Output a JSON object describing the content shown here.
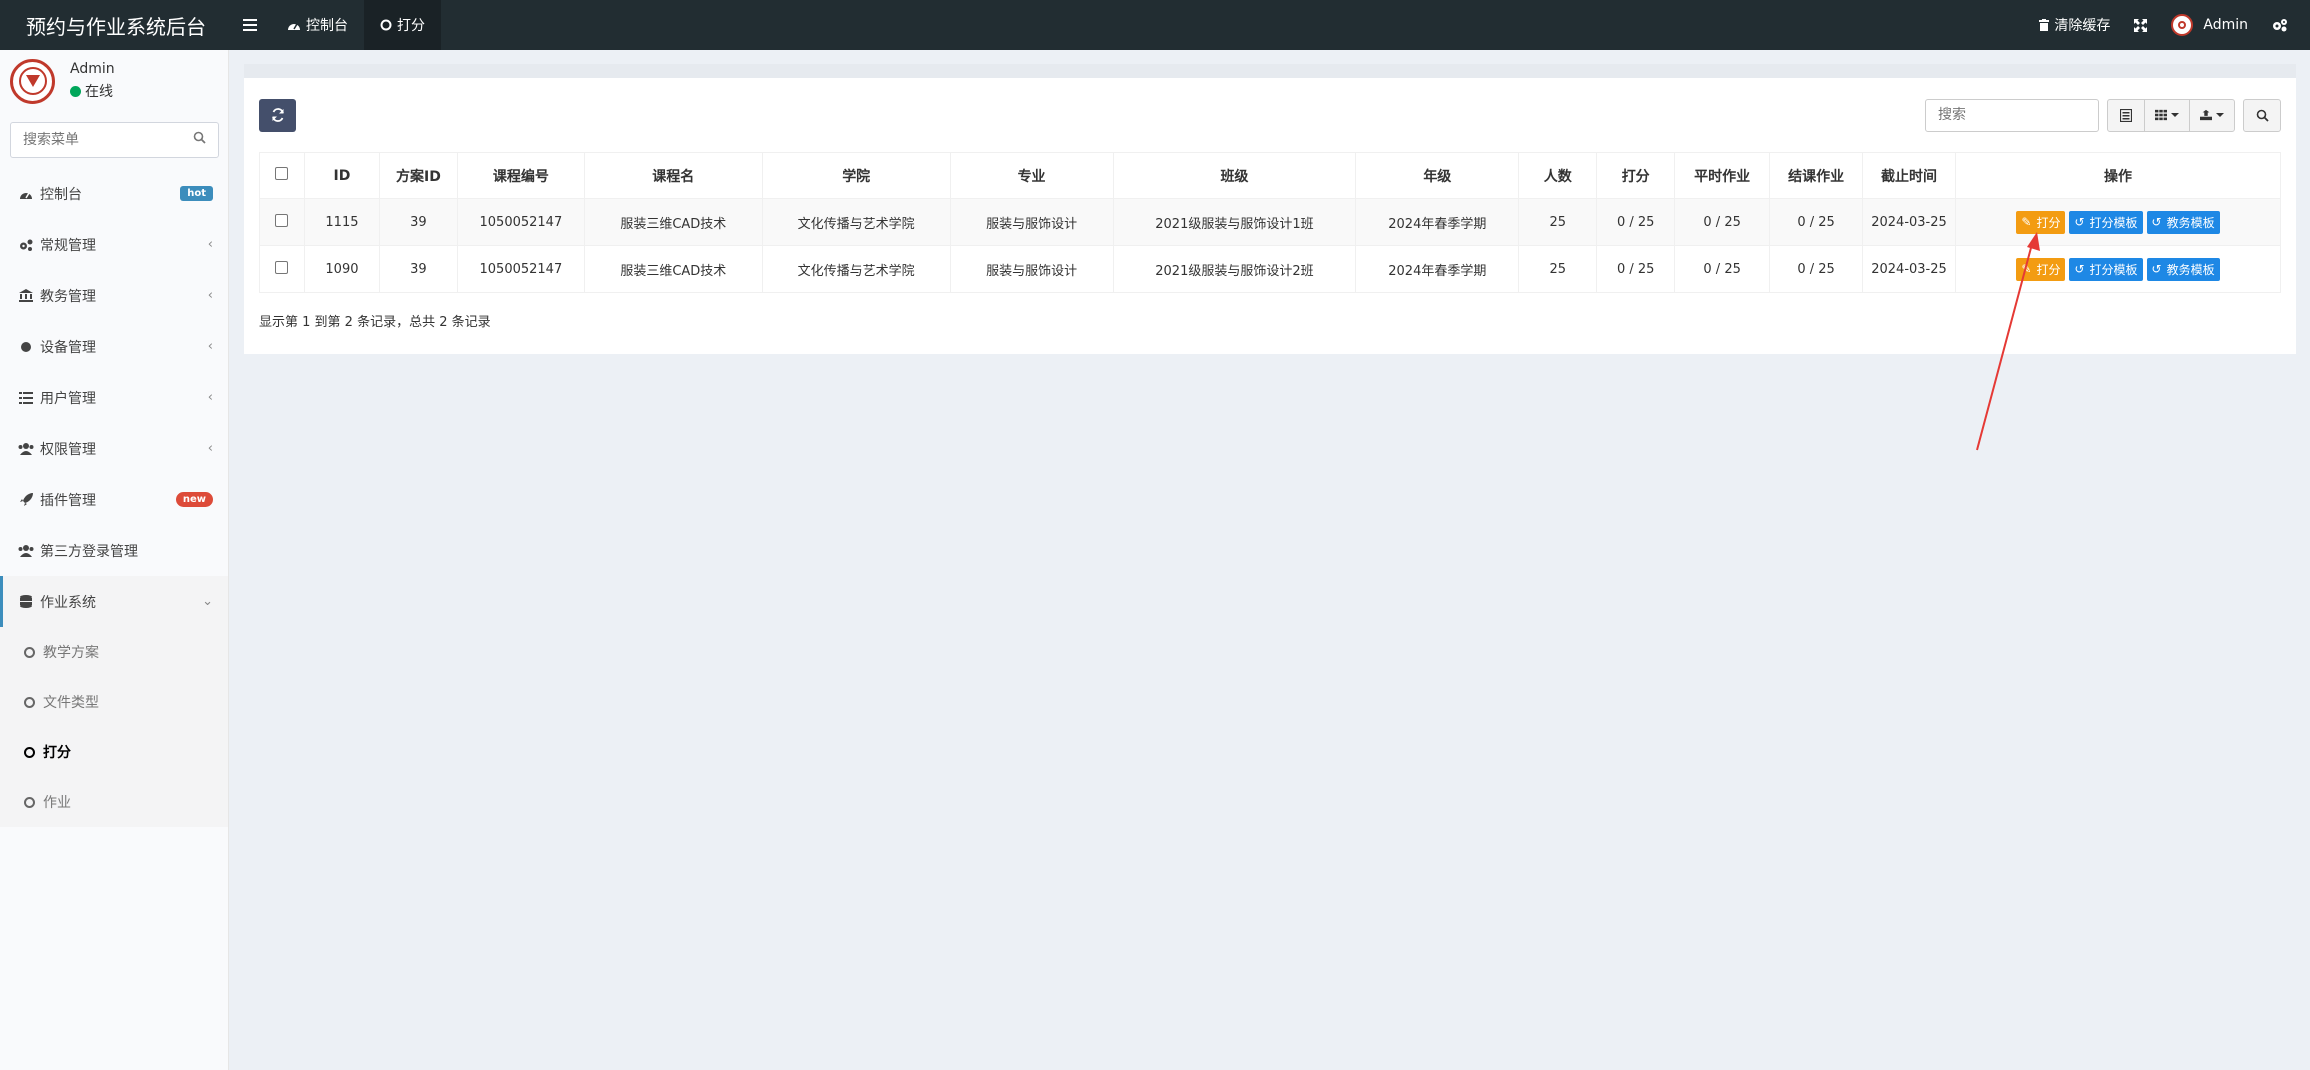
{
  "app": {
    "title": "预约与作业系统后台"
  },
  "topnav": {
    "tabs": [
      {
        "label": "控制台"
      },
      {
        "label": "打分"
      }
    ],
    "clear_cache": "清除缓存",
    "user": "Admin"
  },
  "sidebar": {
    "user": {
      "name": "Admin",
      "status": "在线"
    },
    "search_placeholder": "搜索菜单",
    "items": [
      {
        "label": "控制台",
        "badge": "hot"
      },
      {
        "label": "常规管理"
      },
      {
        "label": "教务管理"
      },
      {
        "label": "设备管理"
      },
      {
        "label": "用户管理"
      },
      {
        "label": "权限管理"
      },
      {
        "label": "插件管理",
        "badge": "new"
      },
      {
        "label": "第三方登录管理"
      },
      {
        "label": "作业系统"
      }
    ],
    "subitems": [
      {
        "label": "教学方案"
      },
      {
        "label": "文件类型"
      },
      {
        "label": "打分"
      },
      {
        "label": "作业"
      }
    ]
  },
  "toolbar": {
    "search_placeholder": "搜索"
  },
  "table": {
    "headers": [
      "ID",
      "方案ID",
      "课程编号",
      "课程名",
      "学院",
      "专业",
      "班级",
      "年级",
      "人数",
      "打分",
      "平时作业",
      "结课作业",
      "截止时间",
      "操作"
    ],
    "rows": [
      [
        "1115",
        "39",
        "1050052147",
        "服装三维CAD技术",
        "文化传播与艺术学院",
        "服装与服饰设计",
        "2021级服装与服饰设计1班",
        "2024年春季学期",
        "25",
        "0 / 25",
        "0 / 25",
        "0 / 25",
        "2024-03-25"
      ],
      [
        "1090",
        "39",
        "1050052147",
        "服装三维CAD技术",
        "文化传播与艺术学院",
        "服装与服饰设计",
        "2021级服装与服饰设计2班",
        "2024年春季学期",
        "25",
        "0 / 25",
        "0 / 25",
        "0 / 25",
        "2024-03-25"
      ]
    ],
    "actions": {
      "score": "打分",
      "score_template": "打分模板",
      "academic_template": "教务模板"
    },
    "pagination_text": "显示第 1 到第 2 条记录，总共 2 条记录"
  },
  "colors": {
    "accent": "#3c8dbc",
    "topbar": "#222d32",
    "warning": "#f39c12",
    "info": "#1e88e5",
    "annotation_arrow": "#e53935"
  }
}
